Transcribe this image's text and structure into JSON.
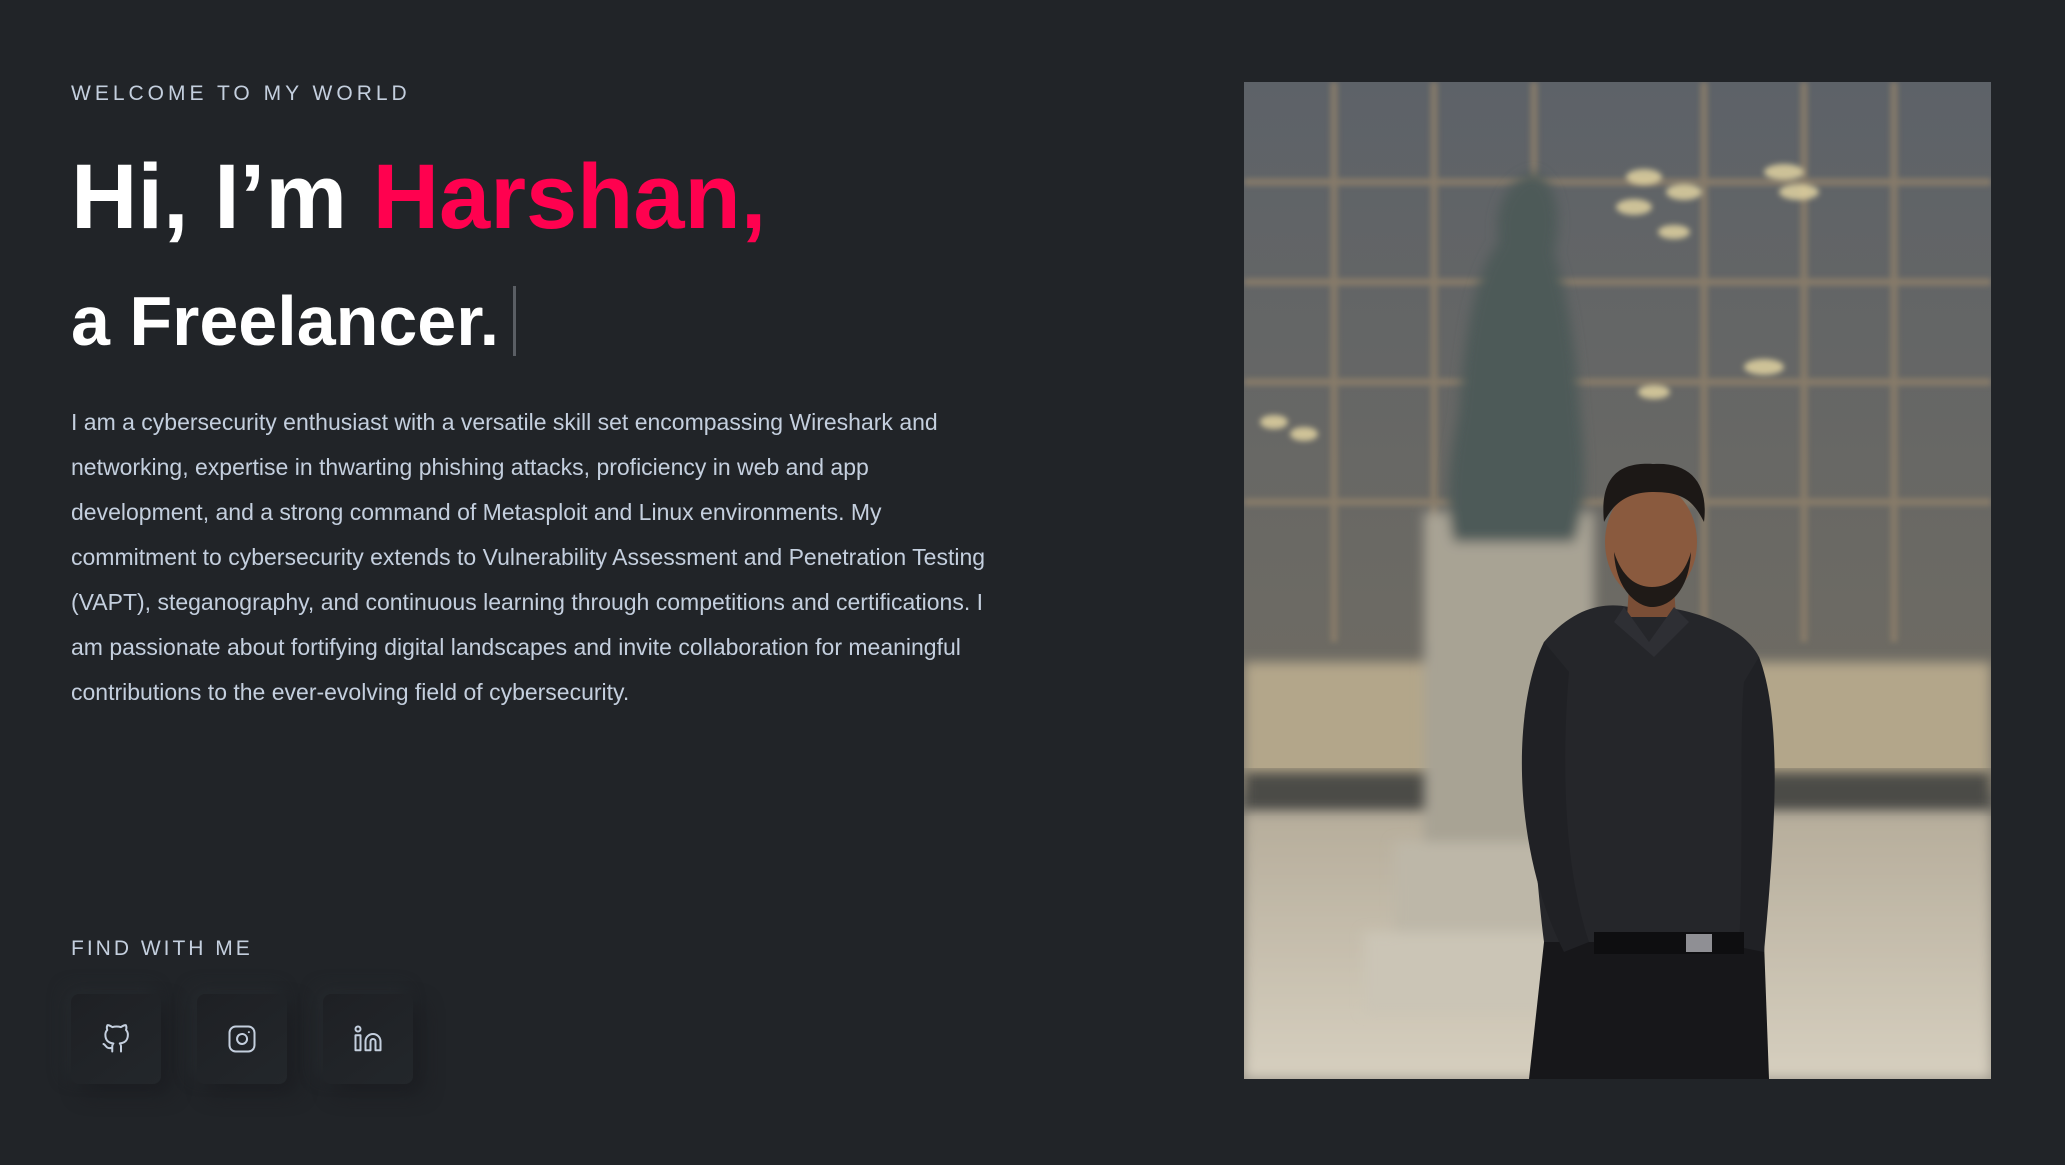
{
  "hero": {
    "eyebrow": "WELCOME TO MY WORLD",
    "greeting": "Hi, I’m ",
    "name": "Harshan,",
    "role_line": "a Freelancer.",
    "bio": "I am a cybersecurity enthusiast with a versatile skill set encompassing Wireshark and networking, expertise in thwarting phishing attacks, proficiency in web and app development, and a strong command of Metasploit and Linux environments. My commitment to cybersecurity extends to Vulnerability Assessment and Penetration Testing (VAPT), steganography, and continuous learning through competitions and certifications. I am passionate about fortifying digital landscapes and invite collaboration for meaningful contributions to the ever-evolving field of cybersecurity."
  },
  "socials": {
    "heading": "FIND WITH ME",
    "items": [
      {
        "icon": "github-icon"
      },
      {
        "icon": "instagram-icon"
      },
      {
        "icon": "linkedin-icon"
      }
    ]
  },
  "colors": {
    "background": "#212428",
    "accent": "#ff014f",
    "body_text": "#c4cfde",
    "heading_text": "#ffffff"
  }
}
